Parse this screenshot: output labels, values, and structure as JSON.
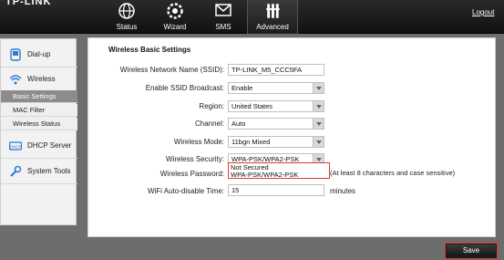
{
  "header": {
    "logo_text": "TP-LINK",
    "logout_label": "Logout",
    "nav": [
      {
        "label": "Status",
        "icon": "globe-icon"
      },
      {
        "label": "Wizard",
        "icon": "gear-icon"
      },
      {
        "label": "SMS",
        "icon": "envelope-icon"
      },
      {
        "label": "Advanced",
        "icon": "tools-icon"
      }
    ]
  },
  "sidebar": {
    "items": [
      {
        "label": "Dial-up",
        "icon": "dialup-icon"
      },
      {
        "label": "Wireless",
        "icon": "wifi-icon"
      },
      {
        "label": "DHCP Server",
        "icon": "dhcp-icon"
      },
      {
        "label": "System Tools",
        "icon": "wrench-icon"
      }
    ],
    "wireless_sub": [
      "Basic Settings",
      "MAC Filter",
      "Wireless Status"
    ],
    "active_sub": "Basic Settings"
  },
  "form": {
    "title": "Wireless Basic Settings",
    "ssid": {
      "label": "Wireless Network Name (SSID):",
      "value": "TP-LINK_M5_CCC5FA"
    },
    "ssid_broadcast": {
      "label": "Enable SSID Broadcast:",
      "value": "Enable"
    },
    "region": {
      "label": "Region:",
      "value": "United States"
    },
    "channel": {
      "label": "Channel:",
      "value": "Auto"
    },
    "mode": {
      "label": "Wireless Mode:",
      "value": "11bgn Mixed"
    },
    "security": {
      "label": "Wireless Security:",
      "value": "WPA-PSK/WPA2-PSK"
    },
    "password": {
      "label": "Wireless Password:",
      "options": [
        "Not Secured",
        "WPA-PSK/WPA2-PSK"
      ],
      "hint": "(At least 8 characters and case sensitive)"
    },
    "auto_disable": {
      "label": "WiFi Auto-disable Time:",
      "value": "15",
      "unit": "minutes"
    },
    "save_label": "Save"
  },
  "colors": {
    "highlight_border": "#e03a2b",
    "active_sub_bg": "#8c8c8c"
  }
}
